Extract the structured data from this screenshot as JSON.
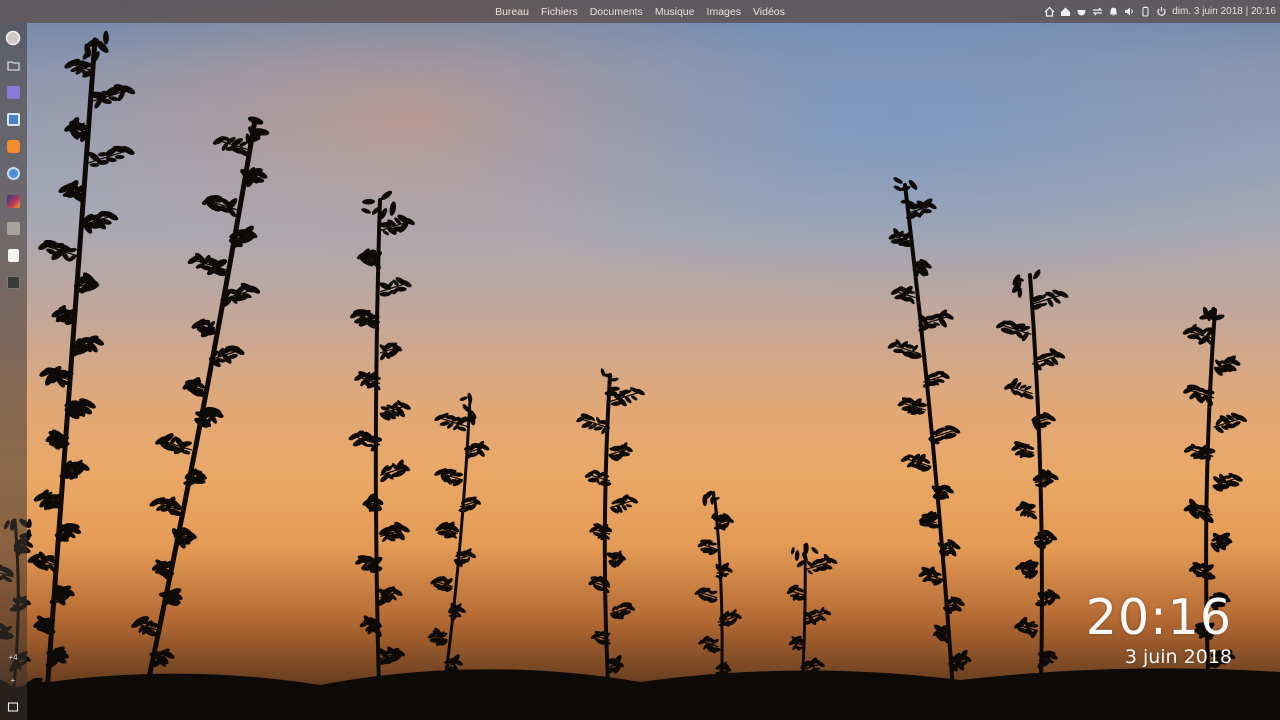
{
  "top_panel": {
    "places": [
      "Bureau",
      "Fichiers",
      "Documents",
      "Musique",
      "Images",
      "Vidéos"
    ],
    "clock": "dim.  3 juin 2018  |  20:16",
    "indicator_icons": [
      "home-icon",
      "home-alt-icon",
      "cup-icon",
      "network-icon",
      "notification-bell-icon",
      "volume-icon",
      "battery-icon",
      "power-icon"
    ]
  },
  "launcher": {
    "items": [
      {
        "name": "app-menu-icon",
        "color": "#d9d4d0"
      },
      {
        "name": "folder-icon",
        "color": "#e8e4e0"
      },
      {
        "name": "files-app-icon",
        "color": "#8a7ad6"
      },
      {
        "name": "window-app-icon",
        "color": "#4a7fc9"
      },
      {
        "name": "firefox-icon",
        "color": "#f28a2e"
      },
      {
        "name": "chromium-icon",
        "color": "#4d8fd6"
      },
      {
        "name": "monitor-app-icon",
        "color": "#c23b5a"
      },
      {
        "name": "tools-app-icon",
        "color": "#a7a39b"
      },
      {
        "name": "document-icon",
        "color": "#f2f2f2"
      },
      {
        "name": "terminal-icon",
        "color": "#3a3a3a"
      }
    ],
    "workspace_label": "+4",
    "add_label": "+"
  },
  "desktop_clock": {
    "time": "20:16",
    "date": "3 juin 2018"
  }
}
